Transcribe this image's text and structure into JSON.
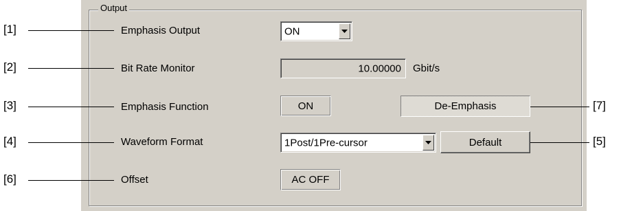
{
  "group": {
    "title": "Output"
  },
  "rows": [
    {
      "callout": "[1]",
      "label": "Emphasis Output"
    },
    {
      "callout": "[2]",
      "label": "Bit Rate Monitor"
    },
    {
      "callout": "[3]",
      "label": "Emphasis Function"
    },
    {
      "callout": "[4]",
      "label": "Waveform Format"
    },
    {
      "callout": "[6]",
      "label": "Offset"
    }
  ],
  "controls": {
    "emphasis_output": {
      "value": "ON"
    },
    "bit_rate_monitor": {
      "value": "10.00000",
      "unit": "Gbit/s"
    },
    "emphasis_function": {
      "label": "ON"
    },
    "de_emphasis": {
      "label": "De-Emphasis",
      "callout": "[7]"
    },
    "waveform_format": {
      "value": "1Post/1Pre-cursor"
    },
    "default_button": {
      "label": "Default",
      "callout": "[5]"
    },
    "offset": {
      "label": "AC OFF"
    }
  },
  "icons": {
    "dropdown": "chevron-down-icon"
  }
}
